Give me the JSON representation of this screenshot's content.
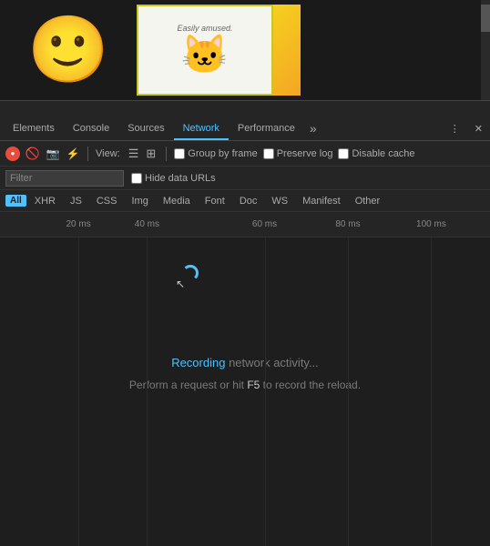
{
  "browser": {
    "images": [
      {
        "type": "emoji",
        "emoji": "😊",
        "alt": "smiley emoji with apple"
      },
      {
        "type": "pusheen",
        "text": "Easily amused.",
        "alt": "Pusheen cat"
      },
      {
        "type": "chip",
        "alt": "partially visible yellow image"
      }
    ]
  },
  "devtools": {
    "tabs": [
      {
        "id": "elements",
        "label": "Elements",
        "active": false
      },
      {
        "id": "console",
        "label": "Console",
        "active": false
      },
      {
        "id": "sources",
        "label": "Sources",
        "active": false
      },
      {
        "id": "network",
        "label": "Network",
        "active": true
      },
      {
        "id": "performance",
        "label": "Performance",
        "active": false
      },
      {
        "id": "overflow",
        "label": "»",
        "active": false
      }
    ],
    "toolbar": {
      "view_label": "View:",
      "group_by_frame_label": "Group by frame",
      "preserve_log_label": "Preserve log",
      "disable_cache_label": "Disable cache"
    },
    "filter": {
      "placeholder": "Filter",
      "hide_data_urls_label": "Hide data URLs"
    },
    "type_filters": [
      "All",
      "XHR",
      "JS",
      "CSS",
      "Img",
      "Media",
      "Font",
      "Doc",
      "WS",
      "Manifest",
      "Other"
    ],
    "active_type": "All",
    "timeline": {
      "markers": [
        {
          "label": "20 ms",
          "position": 16
        },
        {
          "label": "40 ms",
          "position": 30
        },
        {
          "label": "60 ms",
          "position": 54
        },
        {
          "label": "80 ms",
          "position": 71
        },
        {
          "label": "100 ms",
          "position": 88
        }
      ]
    },
    "messages": {
      "recording": "Recording",
      "recording_suffix": " network activity...",
      "hint": "Perform a request or hit ",
      "key": "F5",
      "hint_suffix": " to record the reload."
    }
  }
}
